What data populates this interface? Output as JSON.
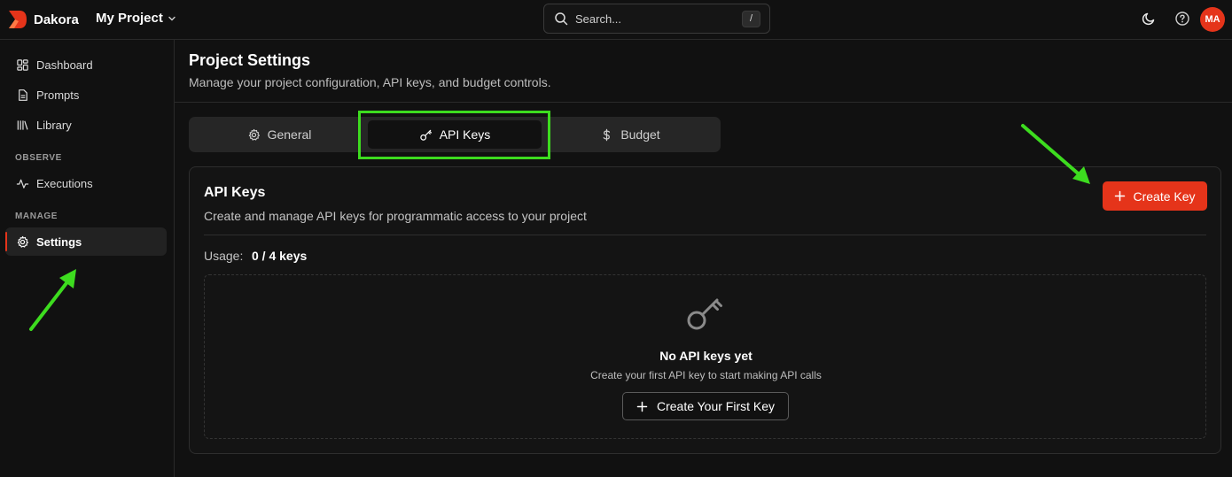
{
  "brand": {
    "name": "Dakora",
    "color": "#e5341a"
  },
  "project": {
    "name": "My Project"
  },
  "search": {
    "placeholder": "Search...",
    "shortcut": "/"
  },
  "user": {
    "initials": "MA"
  },
  "sidebar": {
    "items": [
      {
        "label": "Dashboard",
        "icon": "dashboard-icon"
      },
      {
        "label": "Prompts",
        "icon": "document-icon"
      },
      {
        "label": "Library",
        "icon": "library-icon"
      }
    ],
    "observe_heading": "OBSERVE",
    "observe_items": [
      {
        "label": "Executions",
        "icon": "activity-icon"
      }
    ],
    "manage_heading": "MANAGE",
    "manage_items": [
      {
        "label": "Settings",
        "icon": "gear-icon",
        "active": true
      }
    ]
  },
  "header": {
    "title": "Project Settings",
    "subtitle": "Manage your project configuration, API keys, and budget controls."
  },
  "tabs": [
    {
      "label": "General",
      "icon": "gear-icon",
      "active": false
    },
    {
      "label": "API Keys",
      "icon": "key-icon",
      "active": true
    },
    {
      "label": "Budget",
      "icon": "dollar-icon",
      "active": false
    }
  ],
  "card": {
    "title": "API Keys",
    "description": "Create and manage API keys for programmatic access to your project",
    "create_button": "Create Key",
    "usage_label": "Usage:",
    "usage_value": "0 / 4 keys",
    "empty": {
      "title": "No API keys yet",
      "description": "Create your first API key to start making API calls",
      "button": "Create Your First Key"
    }
  },
  "annotation_color": "#3ddc1f"
}
